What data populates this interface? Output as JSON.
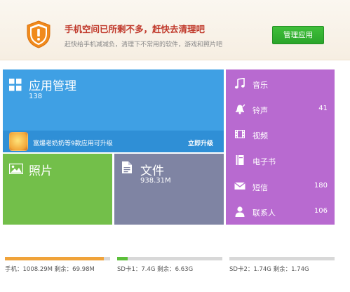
{
  "banner": {
    "title": "手机空间已所剩不多，赶快去清理吧",
    "subtitle": "赶快给手机减减负，清理下不常用的软件，游戏和照片吧",
    "button_label": "管理应用",
    "icon": "warning-shield-icon",
    "icon_color": "#f08a1c"
  },
  "tiles": {
    "apps": {
      "icon": "grid-icon",
      "title": "应用管理",
      "count": "138",
      "update_text": "富爆老奶奶等9款应用可升级",
      "update_link": "立即升级",
      "color": "#3fa0e4"
    },
    "photos": {
      "icon": "photo-icon",
      "title": "照片",
      "color": "#73bf4a"
    },
    "files": {
      "icon": "file-icon",
      "title": "文件",
      "count": "938.31M",
      "color": "#7f84a3"
    }
  },
  "media": {
    "color": "#b86ad0",
    "items": [
      {
        "icon": "music-note-icon",
        "label": "音乐",
        "count": ""
      },
      {
        "icon": "bell-icon",
        "label": "铃声",
        "count": "41"
      },
      {
        "icon": "film-icon",
        "label": "视频",
        "count": ""
      },
      {
        "icon": "book-icon",
        "label": "电子书",
        "count": ""
      },
      {
        "icon": "envelope-icon",
        "label": "短信",
        "count": "180"
      },
      {
        "icon": "person-icon",
        "label": "联系人",
        "count": "106"
      }
    ]
  },
  "storage": [
    {
      "text": "手机：1008.29M    剩余：69.98M",
      "used_fraction": 0.94,
      "color": "#f0a33a"
    },
    {
      "text": "SD卡1：7.4G    剩余：6.63G",
      "used_fraction": 0.1,
      "color": "#5cbf3a"
    },
    {
      "text": "SD卡2：1.74G    剩余：1.74G",
      "used_fraction": 0.0,
      "color": "#3fa0e4"
    }
  ]
}
